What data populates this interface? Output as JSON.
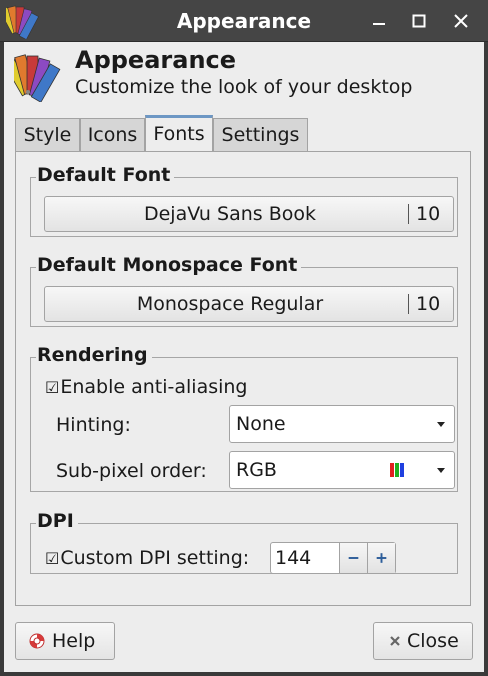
{
  "window": {
    "title": "Appearance",
    "minimize_icon": "minimize-icon",
    "maximize_icon": "maximize-icon",
    "close_icon": "close-icon"
  },
  "header": {
    "title": "Appearance",
    "subtitle": "Customize the look of your desktop",
    "icon": "color-swatches-icon"
  },
  "tabs": [
    {
      "label": "Style"
    },
    {
      "label": "Icons"
    },
    {
      "label": "Fonts",
      "active": true
    },
    {
      "label": "Settings"
    }
  ],
  "default_font": {
    "heading": "Default Font",
    "font_name": "DejaVu Sans Book",
    "font_size": "10"
  },
  "monospace_font": {
    "heading": "Default Monospace Font",
    "font_name": "Monospace Regular",
    "font_size": "10"
  },
  "rendering": {
    "heading": "Rendering",
    "antialias_label": "Enable anti-aliasing",
    "antialias_checked": true,
    "hinting_label": "Hinting:",
    "hinting_value": "None",
    "subpixel_label": "Sub-pixel order:",
    "subpixel_value": "RGB"
  },
  "dpi": {
    "heading": "DPI",
    "custom_label": "Custom DPI setting:",
    "custom_checked": true,
    "value": "144",
    "minus_label": "−",
    "plus_label": "+"
  },
  "buttons": {
    "help_label": "Help",
    "close_label": "Close"
  },
  "colors": {
    "titlebar": "#454545",
    "window_bg": "#ededed",
    "active_tab_accent": "#6d97c4",
    "spin_symbol": "#2d5e9a"
  }
}
